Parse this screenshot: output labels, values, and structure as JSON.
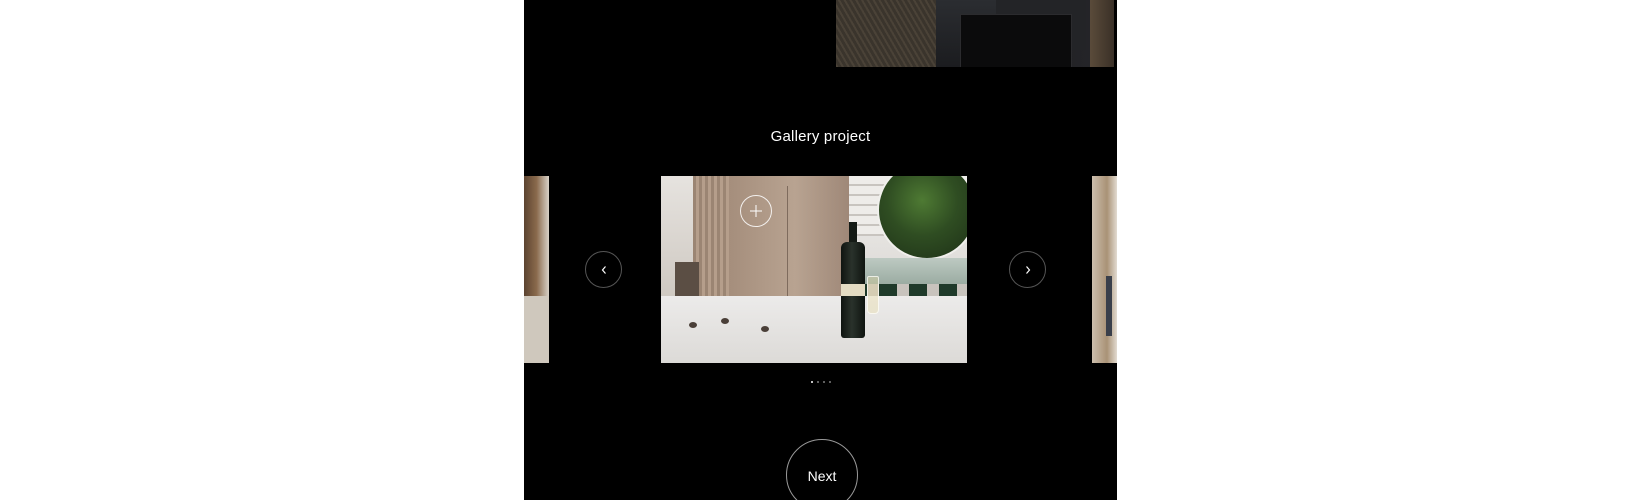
{
  "gallery": {
    "title": "Gallery project",
    "slides": [
      {
        "position": "previous"
      },
      {
        "position": "current"
      },
      {
        "position": "next"
      }
    ],
    "pagination": {
      "total": 4,
      "active": 1
    },
    "prev_icon": "chevron-left-icon",
    "next_icon": "chevron-right-icon",
    "zoom_icon": "plus-icon"
  },
  "footer": {
    "next_label": "Next"
  },
  "colors": {
    "page_background": "#000000",
    "outer_background": "#ffffff",
    "text": "#ffffff",
    "control_border": "#555555"
  }
}
